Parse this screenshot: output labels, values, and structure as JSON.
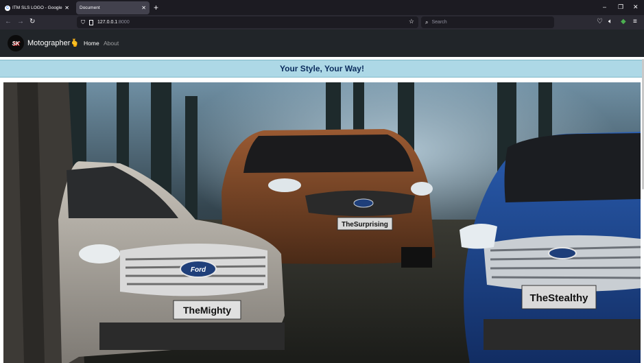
{
  "browser": {
    "tabs": [
      {
        "label": "ITM SLS LOGO - Google Search",
        "active": false
      },
      {
        "label": "Document",
        "active": true
      }
    ],
    "new_tab": "+",
    "controls": {
      "minimize": "–",
      "restore": "❐",
      "close": "✕"
    },
    "url": {
      "host": "127.0.0.1",
      "port": ":8000"
    },
    "search_placeholder": "Search",
    "icons": [
      "back-arrow-icon",
      "forward-arrow-icon",
      "reload-icon",
      "shield-icon",
      "page-icon",
      "star-icon",
      "search-icon",
      "pocket-icon",
      "speaker-icon",
      "extension-icon",
      "menu-icon"
    ]
  },
  "site": {
    "logo_text": "SK",
    "brand": "Motographer",
    "brand_emoji": "🫰",
    "nav": [
      {
        "label": "Home",
        "active": true
      },
      {
        "label": "About",
        "active": false
      }
    ],
    "tagline": "Your Style, Your Way!",
    "hero": {
      "plates": [
        "TheSurprising",
        "TheMighty",
        "TheStealthy"
      ],
      "badge": "Ford"
    }
  },
  "colors": {
    "chrome_dark": "#1c1b22",
    "toolbar": "#2b2a33",
    "navbar": "#212529",
    "banner_bg": "#add8e6",
    "banner_text": "#0a2b5c"
  }
}
